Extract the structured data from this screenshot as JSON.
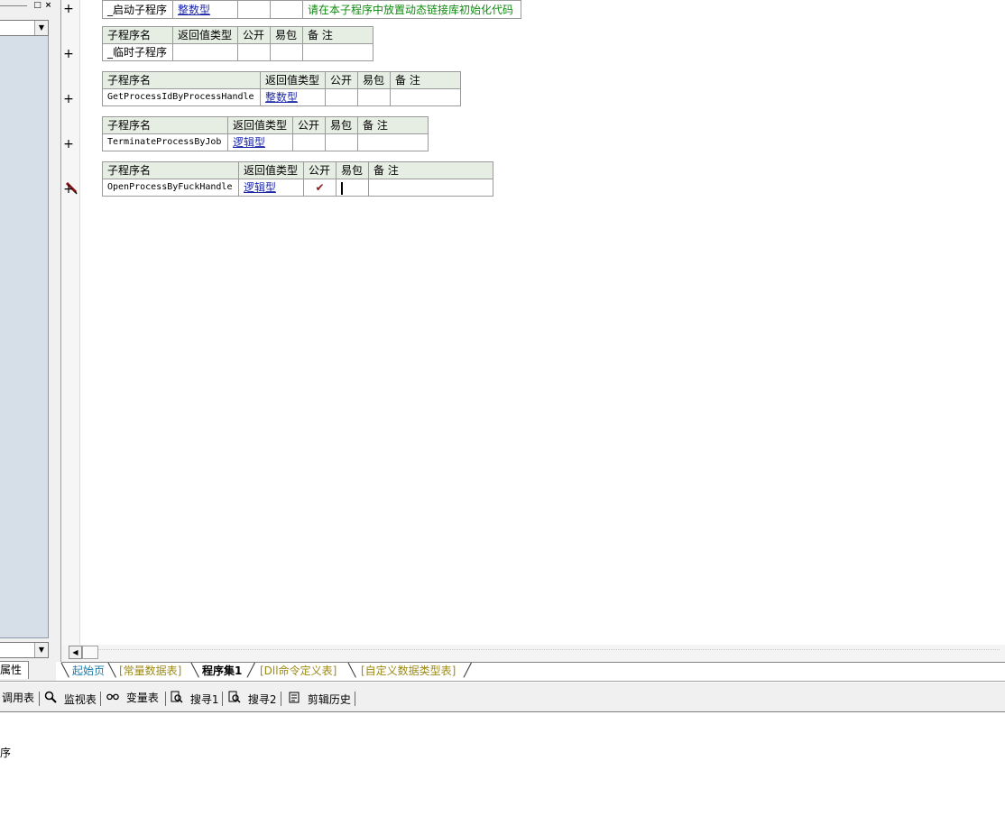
{
  "left_panel": {
    "attr_tab": "属性"
  },
  "subprograms": [
    {
      "header": [
        "子程序名",
        "返回值类型",
        "公开",
        "易包",
        "备 注"
      ],
      "name": "_启动子程序",
      "return_type": "整数型",
      "public": "",
      "easy": "",
      "note": "请在本子程序中放置动态链接库初始化代码"
    },
    {
      "header": [
        "子程序名",
        "返回值类型",
        "公开",
        "易包",
        "备 注"
      ],
      "name": "_临时子程序",
      "return_type": "",
      "public": "",
      "easy": "",
      "note": ""
    },
    {
      "header": [
        "子程序名",
        "返回值类型",
        "公开",
        "易包",
        "备 注"
      ],
      "name": "GetProcessIdByProcessHandle",
      "return_type": "整数型",
      "public": "",
      "easy": "",
      "note": ""
    },
    {
      "header": [
        "子程序名",
        "返回值类型",
        "公开",
        "易包",
        "备 注"
      ],
      "name": "TerminateProcessByJob",
      "return_type": "逻辑型",
      "public": "",
      "easy": "",
      "note": ""
    },
    {
      "header": [
        "子程序名",
        "返回值类型",
        "公开",
        "易包",
        "备 注"
      ],
      "name": "OpenProcessByFuckHandle",
      "return_type": "逻辑型",
      "public": "✔",
      "easy": "",
      "note": ""
    }
  ],
  "expand_symbol": "+",
  "tabs": [
    {
      "label": "起始页",
      "color": "#1a7ca8"
    },
    {
      "label": "[常量数据表]",
      "color": "#9c8a14"
    },
    {
      "label": "程序集1",
      "color": "#000000"
    },
    {
      "label": "[Dll命令定义表]",
      "color": "#9c8a14"
    },
    {
      "label": "[自定义数据类型表]",
      "color": "#9c8a14"
    }
  ],
  "bottom_toolbar": {
    "items": [
      {
        "label": "调用表",
        "icon": ""
      },
      {
        "label": "监视表",
        "icon": "magnifier-icon"
      },
      {
        "label": "变量表",
        "icon": "binoculars-icon"
      },
      {
        "label": "搜寻1",
        "icon": "search-doc-icon"
      },
      {
        "label": "搜寻2",
        "icon": "search-doc-icon"
      },
      {
        "label": "剪辑历史",
        "icon": "clipboard-icon"
      }
    ]
  },
  "output": {
    "text": "序"
  },
  "colors": {
    "header_bg": "#e6ede3",
    "type_link": "#1d28a8",
    "note_green": "#0f8a0f",
    "left_list_bg": "#d6dfe8"
  }
}
